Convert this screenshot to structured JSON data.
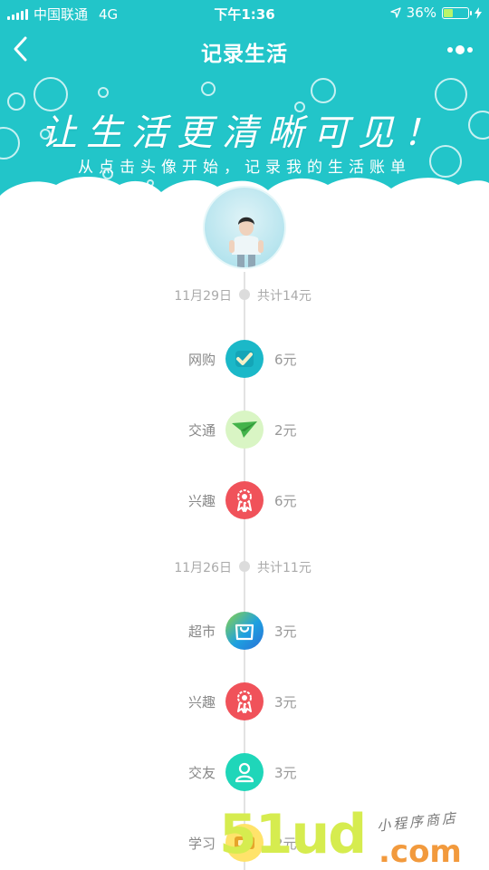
{
  "status_bar": {
    "carrier": "中国联通",
    "network": "4G",
    "time": "下午1:36",
    "battery_percent": "36%",
    "battery_level": 0.36
  },
  "nav": {
    "title": "记录生活",
    "back_icon": "chevron-left-icon",
    "more_icon": "more-dots-icon"
  },
  "banner": {
    "slogan": "让生活更清晰可见！",
    "subtitle": "从点击头像开始，记录我的生活账单"
  },
  "timeline": [
    {
      "date": "11月29日",
      "total": "共计14元",
      "entries": [
        {
          "category": "网购",
          "amount": "6元",
          "icon": "check-icon",
          "color": "#1bb8c8"
        },
        {
          "category": "交通",
          "amount": "2元",
          "icon": "paper-plane-icon",
          "color": "#d9f5c4"
        },
        {
          "category": "兴趣",
          "amount": "6元",
          "icon": "ribbon-award-icon",
          "color": "#f0525a"
        }
      ]
    },
    {
      "date": "11月26日",
      "total": "共计11元",
      "entries": [
        {
          "category": "超市",
          "amount": "3元",
          "icon": "shopping-bag-icon",
          "color": "#2a9ee0"
        },
        {
          "category": "兴趣",
          "amount": "3元",
          "icon": "ribbon-award-icon",
          "color": "#f0525a"
        },
        {
          "category": "交友",
          "amount": "3元",
          "icon": "user-icon",
          "color": "#1fd6b9"
        },
        {
          "category": "学习",
          "amount": "2元",
          "icon": "study-icon",
          "color": "#ffe36a"
        }
      ]
    }
  ],
  "watermark": {
    "number": "51ud",
    "domain": ".com",
    "tag": "小程序商店"
  },
  "colors": {
    "header_bg": "#22c5c9",
    "muted_text": "#aaaaaa"
  }
}
